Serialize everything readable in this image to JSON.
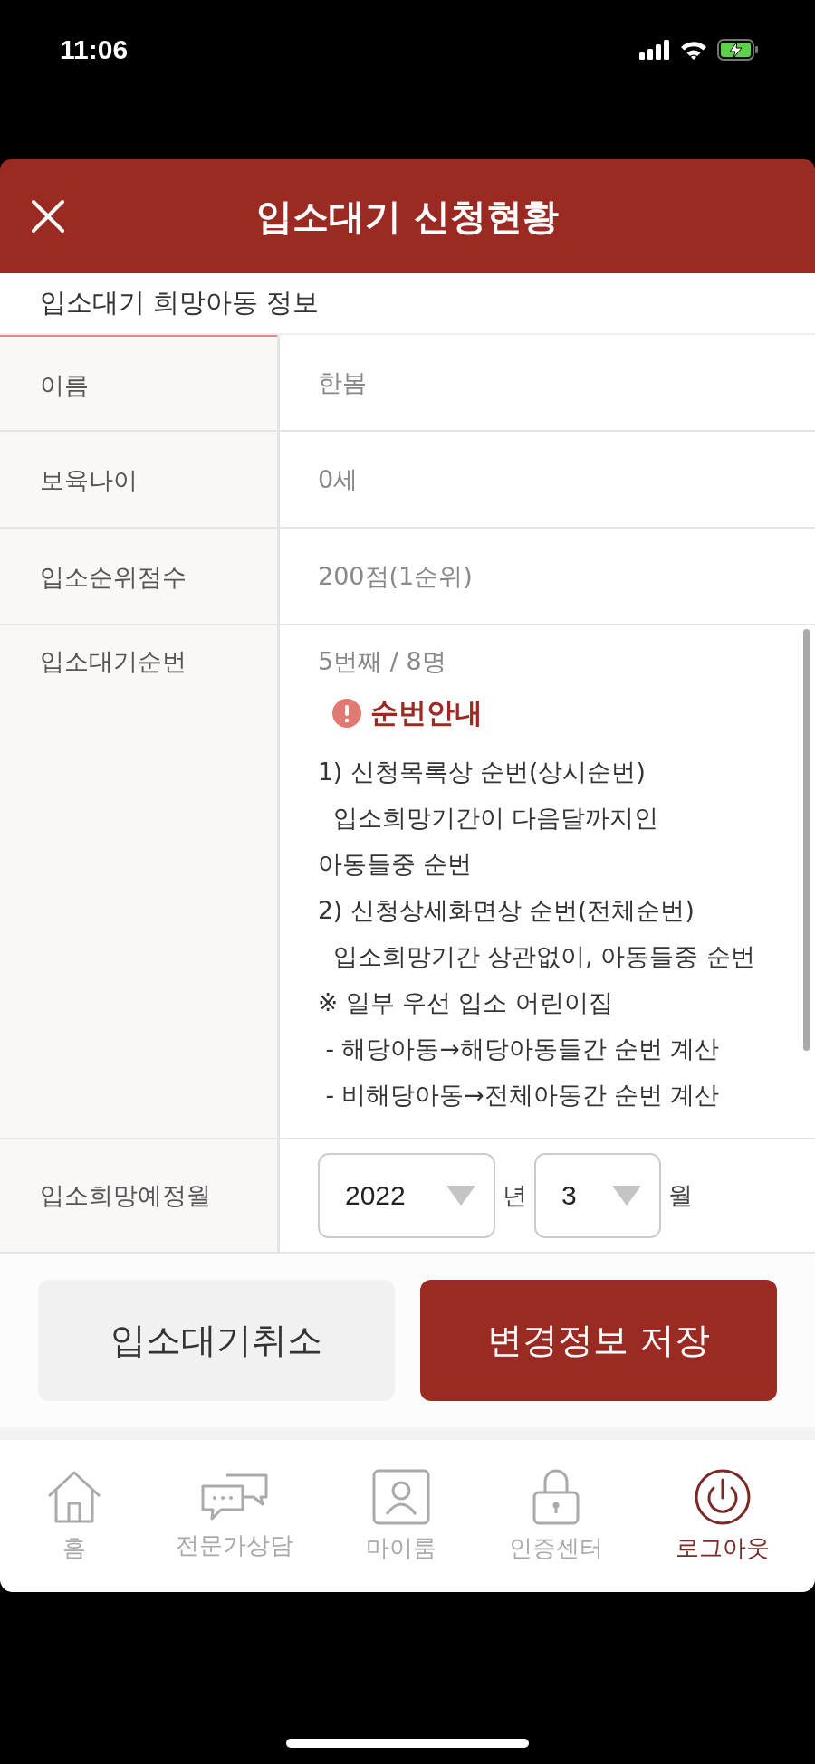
{
  "status_bar": {
    "time": "11:06"
  },
  "header": {
    "title": "입소대기 신청현황"
  },
  "section": {
    "title": "입소대기 희망아동 정보"
  },
  "rows": [
    {
      "kind": "text",
      "label": "이름",
      "value": "한봄"
    },
    {
      "kind": "text",
      "label": "보육나이",
      "value": "0세"
    },
    {
      "kind": "text",
      "label": "입소순위점수",
      "value": "200점(1순위)"
    },
    {
      "kind": "notice",
      "label": "입소대기순번",
      "value": "5번째 / 8명",
      "notice_title": "순번안내",
      "notice_body": "1) 신청목록상 순번(상시순번)\n  입소희망기간이 다음달까지인\n아동들중 순번\n2) 신청상세화면상 순번(전체순번)\n  입소희망기간 상관없이, 아동들중 순번\n※ 일부 우선 입소 어린이집\n - 해당아동→해당아동들간 순번 계산\n - 비해당아동→전체아동간 순번 계산"
    },
    {
      "kind": "month",
      "label": "입소희망예정월",
      "year": "2022",
      "year_unit": "년",
      "month": "3",
      "month_unit": "월"
    }
  ],
  "buttons": [
    {
      "kind": "secondary",
      "label": "입소대기취소"
    },
    {
      "kind": "primary",
      "label": "변경정보 저장"
    }
  ],
  "nav": [
    {
      "kind": "home",
      "label": "홈",
      "selected": false
    },
    {
      "kind": "chat",
      "label": "전문가상담",
      "selected": false
    },
    {
      "kind": "person",
      "label": "마이룸",
      "selected": false
    },
    {
      "kind": "lock",
      "label": "인증센터",
      "selected": false
    },
    {
      "kind": "power",
      "label": "로그아웃",
      "selected": true
    }
  ]
}
